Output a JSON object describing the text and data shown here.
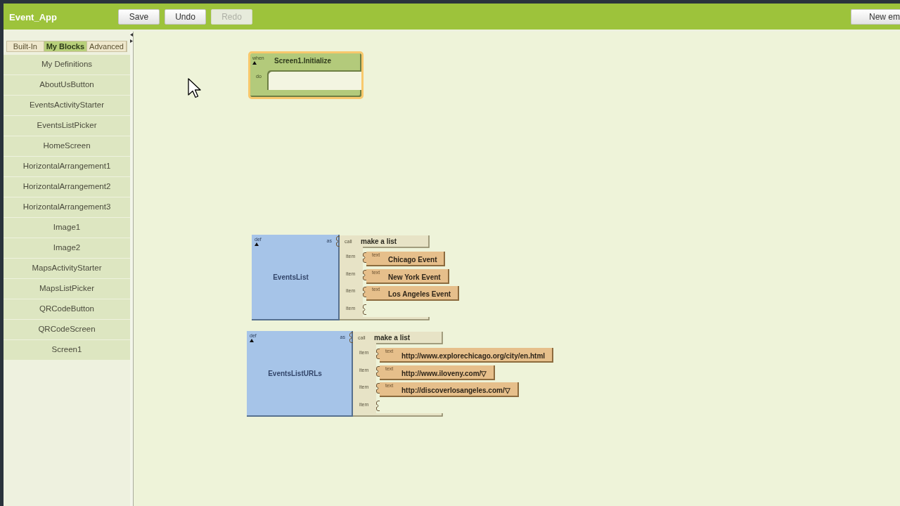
{
  "header": {
    "title": "Event_App",
    "buttons": [
      {
        "label": "Save",
        "disabled": false
      },
      {
        "label": "Undo",
        "disabled": false
      },
      {
        "label": "Redo",
        "disabled": true
      }
    ],
    "right_button": {
      "label": "New em"
    }
  },
  "sidebar": {
    "tabs": [
      {
        "label": "Built-In",
        "selected": false
      },
      {
        "label": "My Blocks",
        "selected": true
      },
      {
        "label": "Advanced",
        "selected": false
      }
    ],
    "items": [
      "My Definitions",
      "AboutUsButton",
      "EventsActivityStarter",
      "EventsListPicker",
      "HomeScreen",
      "HorizontalArrangement1",
      "HorizontalArrangement2",
      "HorizontalArrangement3",
      "Image1",
      "Image2",
      "MapsActivityStarter",
      "MapsListPicker",
      "QRCodeButton",
      "QRCodeScreen",
      "Screen1"
    ]
  },
  "canvas": {
    "blocks": [
      {
        "kind": "event",
        "when_label": "when",
        "name": "Screen1.Initialize",
        "do_label": "do",
        "selected": true
      },
      {
        "kind": "definition",
        "def_label": "def",
        "name": "EventsList",
        "as_label": "as",
        "selected": false,
        "value": {
          "call_label": "call",
          "name": "make a list",
          "items": [
            {
              "kind": "text",
              "label": "item",
              "type_label": "text",
              "value": "Chicago Event"
            },
            {
              "kind": "text",
              "label": "item",
              "type_label": "text",
              "value": "New York Event"
            },
            {
              "kind": "text",
              "label": "item",
              "type_label": "text",
              "value": "Los Angeles Event"
            },
            {
              "kind": "empty",
              "label": "item"
            }
          ]
        }
      },
      {
        "kind": "definition",
        "def_label": "def",
        "name": "EventsListURLs",
        "as_label": "as",
        "selected": false,
        "value": {
          "call_label": "call",
          "name": "make a list",
          "items": [
            {
              "kind": "text",
              "label": "item",
              "type_label": "text",
              "value": "http://www.explorechicago.org/city/en.html"
            },
            {
              "kind": "text",
              "label": "item",
              "type_label": "text",
              "value": "http://www.iloveny.com/▽"
            },
            {
              "kind": "text",
              "label": "item",
              "type_label": "text",
              "value": "http://discoverlosangeles.com/▽"
            },
            {
              "kind": "empty",
              "label": "item"
            }
          ]
        }
      }
    ]
  }
}
